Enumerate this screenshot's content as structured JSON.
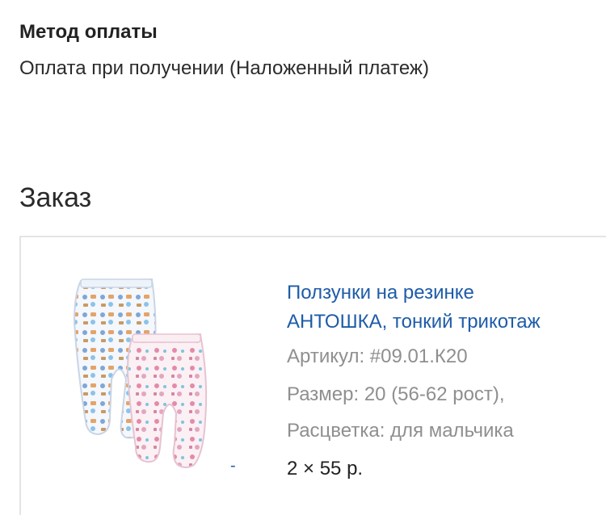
{
  "payment_method": {
    "title": "Метод оплаты",
    "value": "Оплата при получении (Наложенный платеж)"
  },
  "order": {
    "heading": "Заказ",
    "items": [
      {
        "name_line1": "Ползунки на резинке",
        "name_line2": "АНТОШКА, тонкий трикотаж",
        "sku": "Артикул: #09.01.К20",
        "size": "Размер: 20 (56-62 рост),",
        "color": "Расцветка: для мальчика",
        "quantity_price": "2 × 55 р.",
        "image_dash": "-"
      }
    ]
  },
  "colors": {
    "link": "#1e5ca8",
    "muted": "#8f8f8f",
    "text": "#222222",
    "card_border": "#e4e4e4"
  }
}
